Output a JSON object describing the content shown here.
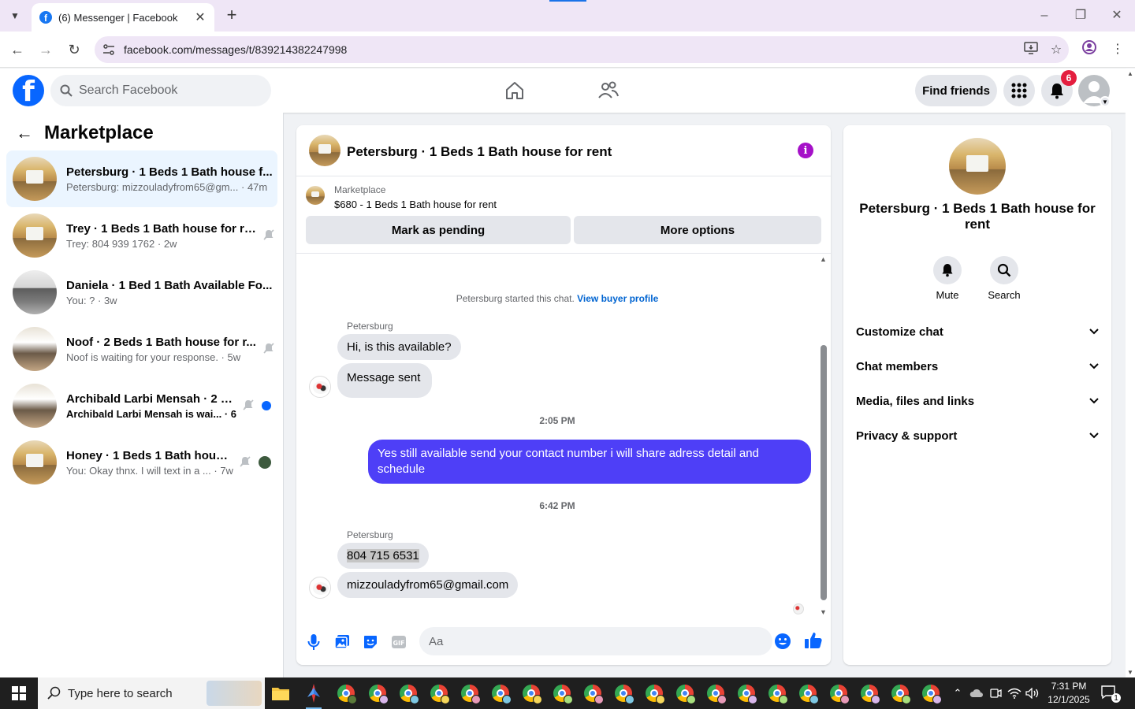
{
  "browser": {
    "tab_title": "(6) Messenger | Facebook",
    "url": "facebook.com/messages/t/839214382247998"
  },
  "fb_header": {
    "search_placeholder": "Search Facebook",
    "find_friends": "Find friends",
    "notification_count": "6"
  },
  "left_panel": {
    "title": "Marketplace",
    "conversations": [
      {
        "name": "Petersburg · 1 Beds 1 Bath house f...",
        "preview": "Petersburg: mizzouladyfrom65@gm... · 47m",
        "muted": false,
        "unread": false
      },
      {
        "name": "Trey · 1 Beds 1 Bath house for rent",
        "preview": "Trey: 804 939 1762 · 2w",
        "muted": true,
        "unread": false
      },
      {
        "name": "Daniela · 1 Bed 1 Bath Available Fo...",
        "preview": "You: ? · 3w",
        "muted": false,
        "unread": false
      },
      {
        "name": "Noof · 2 Beds 1 Bath house for r...",
        "preview": "Noof is waiting for your response. · 5w",
        "muted": true,
        "unread": false
      },
      {
        "name": "Archibald Larbi Mensah · 2 B...",
        "preview": "Archibald Larbi Mensah is wai... · 6w",
        "muted": true,
        "unread": true
      },
      {
        "name": "Honey · 1 Beds 1 Bath house ...",
        "preview": "You: Okay thnx. I will text in a ... · 7w",
        "muted": true,
        "unread": false
      }
    ]
  },
  "chat": {
    "title": "Petersburg · 1 Beds 1 Bath house for rent",
    "listing_source": "Marketplace",
    "listing_title": "$680 - 1 Beds 1 Bath house for rent",
    "mark_pending": "Mark as pending",
    "more_options": "More options",
    "started_text": "Petersburg started this chat.",
    "view_profile": "View buyer profile",
    "sender_name": "Petersburg",
    "msg1": "Hi, is this available?",
    "msg2": "Message sent",
    "time1": "2:05 PM",
    "outgoing": "Yes still available send your contact number i will share adress detail and schedule",
    "time2": "6:42 PM",
    "sender_name2": "Petersburg",
    "msg3": "804 715 6531",
    "msg4": "mizzouladyfrom65@gmail.com",
    "composer_placeholder": "Aa"
  },
  "right_panel": {
    "title": "Petersburg · 1 Beds 1 Bath house for rent",
    "mute": "Mute",
    "search": "Search",
    "sections": [
      "Customize chat",
      "Chat members",
      "Media, files and links",
      "Privacy & support"
    ]
  },
  "taskbar": {
    "search_placeholder": "Type here to search",
    "time": "7:31 PM",
    "date": "12/1/2025",
    "notification_count": "1"
  },
  "colors": {
    "fb_blue": "#0866ff",
    "outgoing_bubble": "#4e3ff7",
    "info_icon": "#a511c8",
    "badge_red": "#e41e3f"
  }
}
